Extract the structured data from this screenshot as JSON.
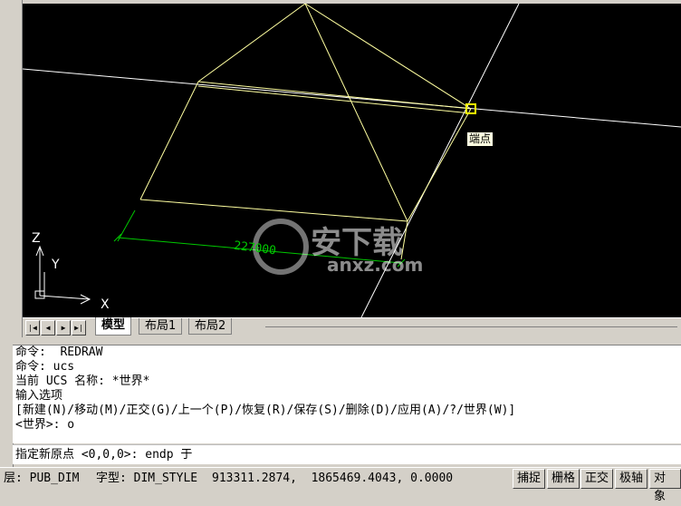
{
  "viewport": {
    "snap_tooltip": "端点",
    "dimension_text": "227000",
    "ucs_axes": {
      "z": "Z",
      "y": "Y",
      "x": "X"
    },
    "watermark": {
      "text_cn": "安下载",
      "text_en": "anxz.com"
    },
    "colors": {
      "background": "#000000",
      "geometry": "#ffffa0",
      "dimension": "#00c800",
      "axes": "#ffffff"
    }
  },
  "tabs": {
    "nav_icons": [
      "first-tab-icon",
      "prev-tab-icon",
      "next-tab-icon",
      "last-tab-icon"
    ],
    "items": [
      {
        "label": "模型",
        "active": true
      },
      {
        "label": "布局1",
        "active": false
      },
      {
        "label": "布局2",
        "active": false
      }
    ]
  },
  "command": {
    "history": [
      "命令:  REDRAW",
      "命令: ucs",
      "当前 UCS 名称: *世界*",
      "输入选项",
      "[新建(N)/移动(M)/正交(G)/上一个(P)/恢复(R)/保存(S)/删除(D)/应用(A)/?/世界(W)]",
      "<世界>: o"
    ],
    "input": "指定新原点 <0,0,0>: endp 于"
  },
  "status": {
    "layer": "层: PUB_DIM",
    "text_style": "字型: DIM_STYLE",
    "coordinates": "913311.2874,  1865469.4043, 0.0000",
    "toggles": [
      "捕捉",
      "栅格",
      "正交",
      "极轴",
      "对象"
    ]
  }
}
